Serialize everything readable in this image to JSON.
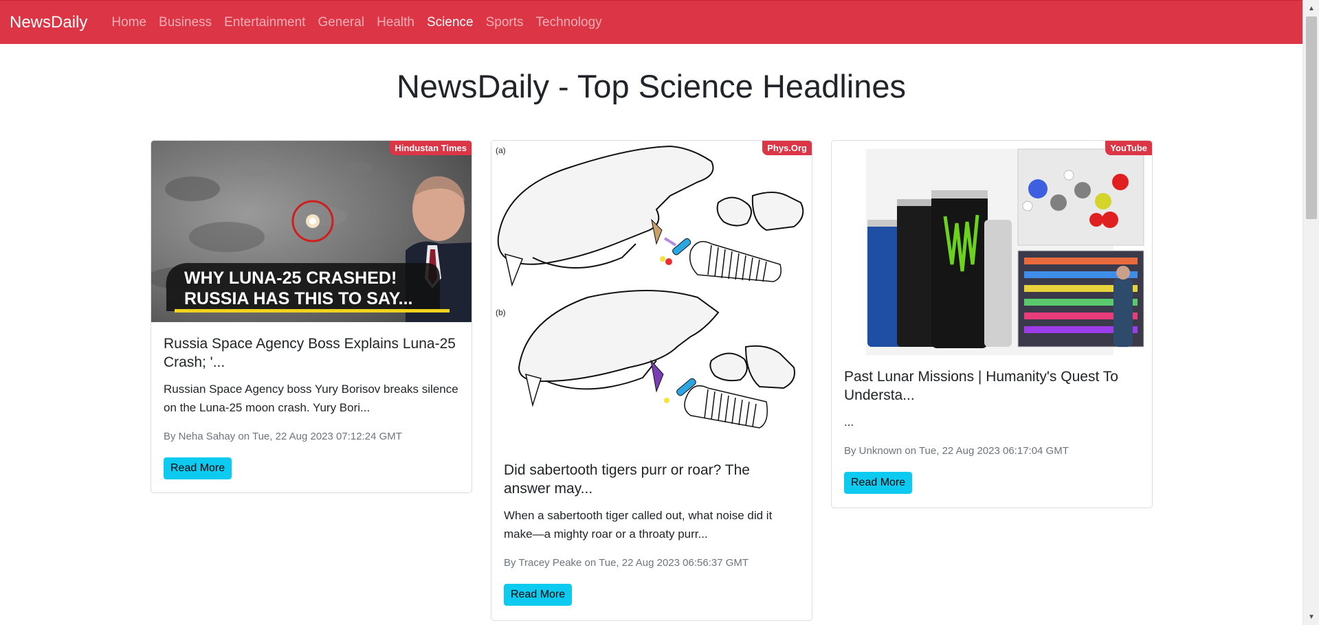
{
  "navbar": {
    "brand": "NewsDaily",
    "links": [
      "Home",
      "Business",
      "Entertainment",
      "General",
      "Health",
      "Science",
      "Sports",
      "Technology"
    ],
    "active": "Science",
    "color": "#dc3545"
  },
  "page": {
    "title": "NewsDaily - Top Science Headlines"
  },
  "articles": [
    {
      "source": "Hindustan Times",
      "image_caption_line1": "WHY LUNA-25 CRASHED!",
      "image_caption_line2": "RUSSIA HAS THIS TO SAY...",
      "title": "Russia Space Agency Boss Explains Luna-25 Crash; '...",
      "description": "Russian Space Agency boss Yury Borisov breaks silence on the Luna-25 moon crash. Yury Bori...",
      "meta": "By Neha Sahay on Tue, 22 Aug 2023 07:12:24 GMT",
      "button": "Read More"
    },
    {
      "source": "Phys.Org",
      "figure_label_a": "(a)",
      "figure_label_b": "(b)",
      "title": "Did sabertooth tigers purr or roar? The answer may...",
      "description": "When a sabertooth tiger called out, what noise did it make—a mighty roar or a throaty purr...",
      "meta": "By Tracey Peake on Tue, 22 Aug 2023 06:56:37 GMT",
      "button": "Read More"
    },
    {
      "source": "YouTube",
      "title": "Past Lunar Missions | Humanity's Quest To Understa...",
      "description": "...",
      "meta": "By Unknown on Tue, 22 Aug 2023 06:17:04 GMT",
      "button": "Read More"
    }
  ],
  "colors": {
    "accent": "#dc3545",
    "button": "#0dcaf0"
  }
}
